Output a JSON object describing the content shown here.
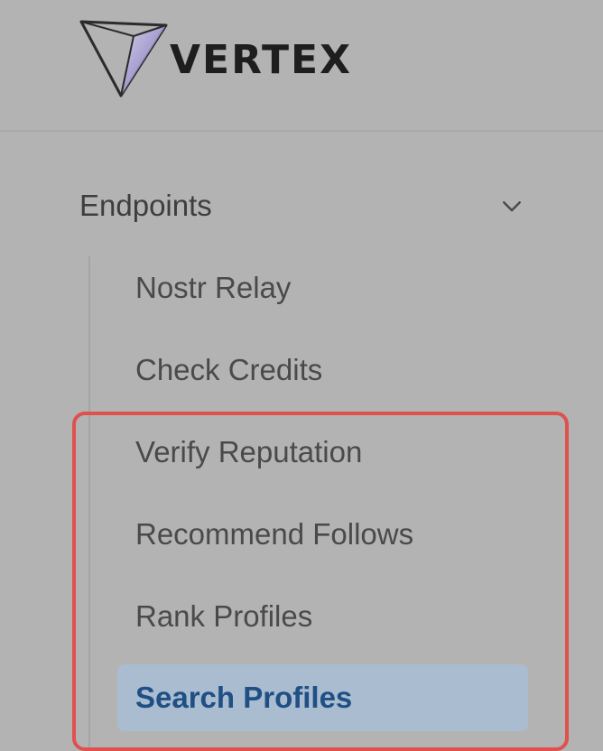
{
  "brand": {
    "name": "VERTEX",
    "logo_icon": "vertex-triangle-logo"
  },
  "sidebar": {
    "section": {
      "title": "Endpoints",
      "expanded": true,
      "toggle_icon": "chevron-down-icon"
    },
    "items": [
      {
        "label": "Nostr Relay",
        "active": false
      },
      {
        "label": "Check Credits",
        "active": false
      },
      {
        "label": "Verify Reputation",
        "active": false
      },
      {
        "label": "Recommend Follows",
        "active": false
      },
      {
        "label": "Rank Profiles",
        "active": false
      },
      {
        "label": "Search Profiles",
        "active": true
      }
    ]
  },
  "colors": {
    "background": "#b3b3b3",
    "active_item_bg": "#aabccf",
    "active_item_text": "#1f4f85",
    "highlight_border": "#e0504c"
  }
}
